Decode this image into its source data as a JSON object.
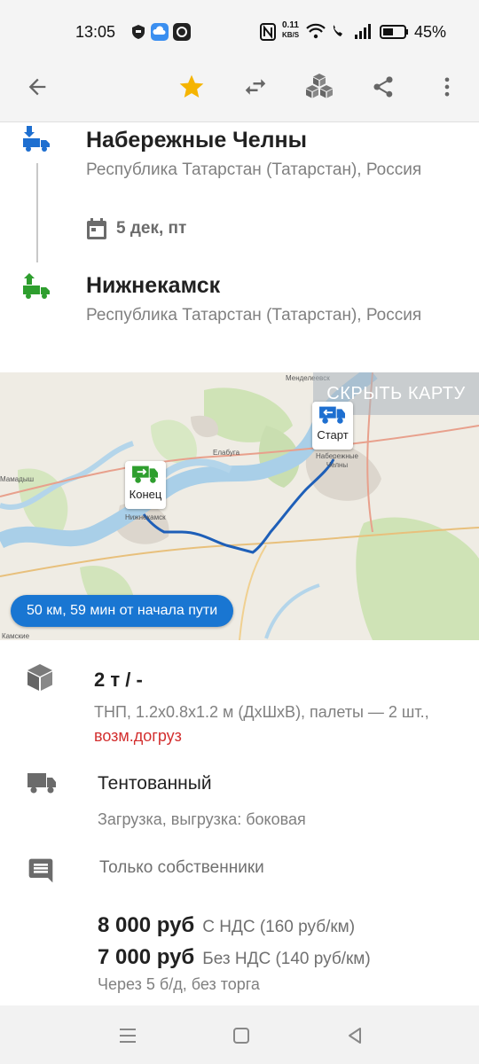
{
  "status_bar": {
    "time": "13:05",
    "net_speed_value": "0.11",
    "net_speed_unit": "KB/S",
    "battery": "45%"
  },
  "toolbar": {
    "icons": [
      "arrow-back-icon",
      "star-icon",
      "swap-icon",
      "boxes-icon",
      "share-icon",
      "more-vert-icon"
    ]
  },
  "route": {
    "origin": {
      "city": "Набережные Челны",
      "region": "Республика Татарстан (Татарстан), Россия",
      "date": "5 дек, пт"
    },
    "destination": {
      "city": "Нижнекамск",
      "region": "Республика Татарстан (Татарстан), Россия"
    }
  },
  "map": {
    "hide_button": "СКРЫТЬ КАРТУ",
    "start_label": "Старт",
    "end_label": "Конец",
    "distance": "50 км, 59 мин от начала пути",
    "place_labels": {
      "chelny": "Набережные Челны",
      "nizhnekamsk": "Нижнекамск",
      "elabuga": "Елабуга",
      "mendeleevsk": "Менделеевск",
      "mamadysh": "Мамадыш",
      "kamskie": "Камские"
    }
  },
  "cargo": {
    "weight": "2 т / -",
    "description": "ТНП, 1.2x0.8x1.2 м (ДхШхВ), палеты — 2 шт.,",
    "extra": "возм.догруз",
    "truck_type": "Тентованный",
    "loading": "Загрузка, выгрузка: боковая",
    "owners": "Только собственники"
  },
  "prices": [
    {
      "amount": "8 000 руб",
      "note": "С НДС (160 руб/км)"
    },
    {
      "amount": "7 000 руб",
      "note": "Без НДС (140 руб/км)"
    }
  ],
  "payment_terms": "Через 5 б/д, без торга",
  "colors": {
    "accent_blue": "#1976d2",
    "load_blue": "#1e6fd0",
    "unload_green": "#2e9e2e",
    "star": "#f5b400",
    "red_text": "#d32f2f"
  }
}
